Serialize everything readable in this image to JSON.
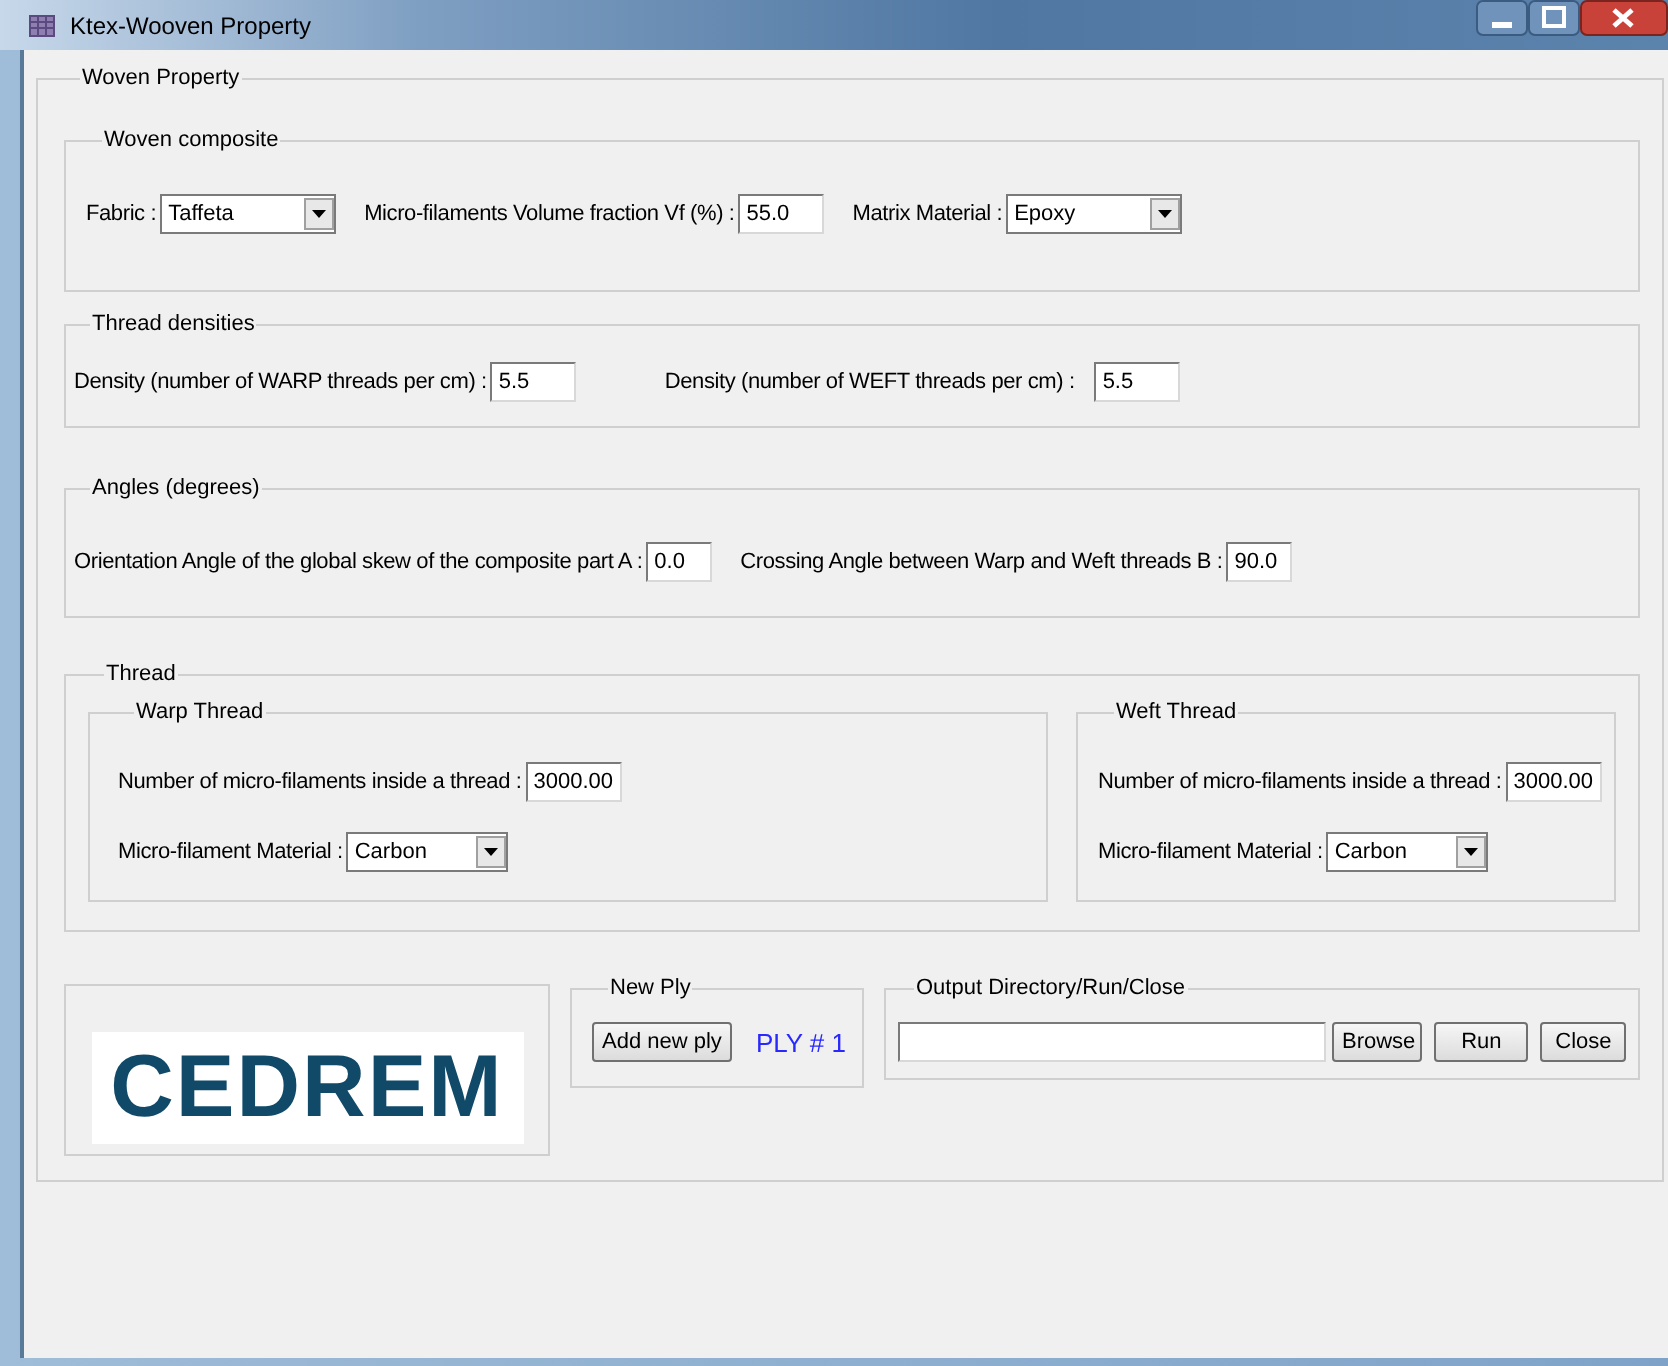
{
  "window": {
    "title": "Ktex-Wooven Property"
  },
  "woven_property": {
    "legend": "Woven Property",
    "sections": [
      {
        "legend": "Woven composite",
        "kind": "composite",
        "fields": [
          {
            "label": "Fabric :",
            "value": "Taffeta",
            "kind": "select"
          },
          {
            "label": "Micro-filaments Volume fraction Vf (%) :",
            "value": "55.0",
            "kind": "input"
          },
          {
            "label": "Matrix Material :",
            "value": "Epoxy",
            "kind": "select"
          }
        ]
      },
      {
        "legend": "Thread densities",
        "kind": "densities",
        "fields": [
          {
            "label": "Density (number of WARP threads per cm) :",
            "value": "5.5",
            "kind": "input"
          },
          {
            "label": "Density (number of WEFT threads per cm) :",
            "value": "5.5",
            "kind": "input"
          }
        ]
      },
      {
        "legend": "Angles (degrees)",
        "kind": "angles",
        "fields": [
          {
            "label": "Orientation Angle of the global skew of the composite part A :",
            "value": "0.0",
            "kind": "input"
          },
          {
            "label": "Crossing Angle between Warp and Weft threads B :",
            "value": "90.0",
            "kind": "input"
          }
        ]
      }
    ],
    "thread": {
      "legend": "Thread",
      "groups": [
        {
          "legend": "Warp Thread",
          "fields": [
            {
              "label": "Number of micro-filaments inside a thread :",
              "value": "3000.00",
              "kind": "input"
            },
            {
              "label": "Micro-filament Material :",
              "value": "Carbon",
              "kind": "select"
            }
          ]
        },
        {
          "legend": "Weft Thread",
          "fields": [
            {
              "label": "Number of micro-filaments inside a thread :",
              "value": "3000.00",
              "kind": "input"
            },
            {
              "label": "Micro-filament Material :",
              "value": "Carbon",
              "kind": "select"
            }
          ]
        }
      ]
    },
    "logo": {
      "text": "CEDREM"
    },
    "new_ply": {
      "legend": "New Ply",
      "button": "Add new ply",
      "ply_label": "PLY # 1"
    },
    "output": {
      "legend": "Output Directory/Run/Close",
      "buttons": [
        "Browse",
        "Run",
        "Close"
      ]
    }
  }
}
